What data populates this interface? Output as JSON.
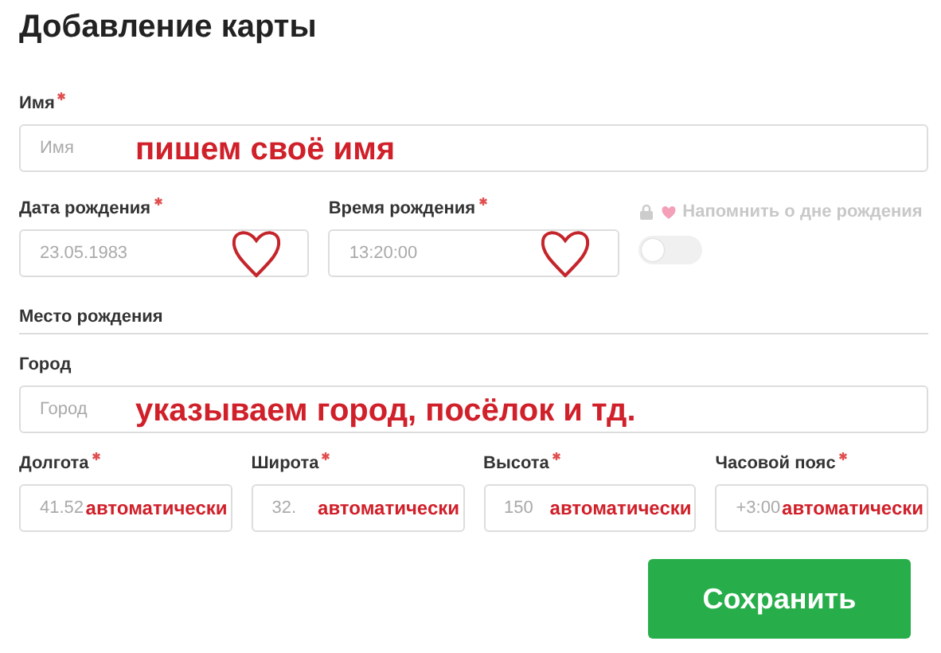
{
  "title": "Добавление карты",
  "form": [
    {
      "kind": "row",
      "fields": [
        {
          "label": "Имя",
          "required": true,
          "placeholder": "Имя",
          "annotation": {
            "kind": "text",
            "text": "пишем своё имя"
          }
        }
      ]
    },
    {
      "kind": "row",
      "fields": [
        {
          "label": "Дата рождения",
          "required": true,
          "placeholder": "23.05.1983",
          "annotation": {
            "kind": "heart"
          }
        },
        {
          "label": "Время рождения",
          "required": true,
          "placeholder": "13:20:00",
          "annotation": {
            "kind": "heart"
          }
        }
      ],
      "reminder": {
        "label": "Напомнить о дне рождения",
        "on": false,
        "disabled": true
      }
    },
    {
      "kind": "heading",
      "text": "Место рождения"
    },
    {
      "kind": "row",
      "fields": [
        {
          "label": "Город",
          "required": false,
          "placeholder": "Город",
          "annotation": {
            "kind": "text",
            "text": "указываем город, посёлок и тд."
          }
        }
      ]
    },
    {
      "kind": "row",
      "fields": [
        {
          "label": "Долгота",
          "required": true,
          "placeholder": "41.52",
          "annotation": {
            "kind": "small",
            "text": "автоматически"
          }
        },
        {
          "label": "Широта",
          "required": true,
          "placeholder": "32.",
          "annotation": {
            "kind": "small",
            "text": "автоматически"
          }
        },
        {
          "label": "Высота",
          "required": true,
          "placeholder": "150",
          "annotation": {
            "kind": "small",
            "text": "автоматически"
          }
        },
        {
          "label": "Часовой пояс",
          "required": true,
          "placeholder": "+3:00",
          "annotation": {
            "kind": "small",
            "text": "автоматически"
          }
        }
      ]
    }
  ],
  "save_button": "Сохранить"
}
